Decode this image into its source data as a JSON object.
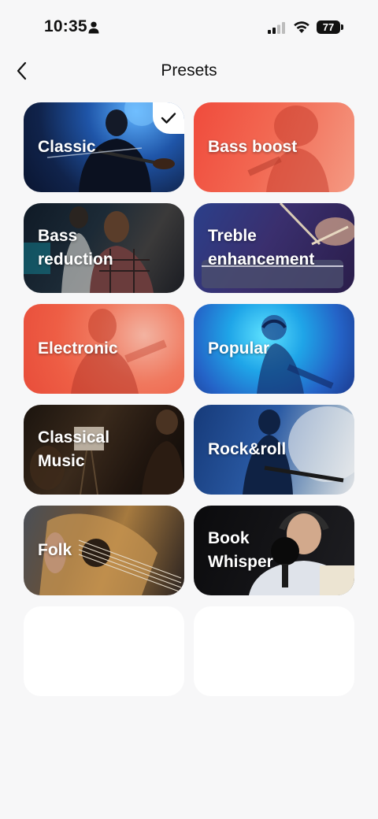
{
  "status_bar": {
    "time": "10:35",
    "battery": "77",
    "icons": [
      "person-icon",
      "signal-icon",
      "wifi-icon",
      "battery-icon"
    ]
  },
  "header": {
    "title": "Presets",
    "back_icon": "chevron-left-icon"
  },
  "presets": [
    {
      "label": "Classic",
      "selected": true
    },
    {
      "label": "Bass boost",
      "selected": false
    },
    {
      "label": "Bass\nreduction",
      "selected": false
    },
    {
      "label": "Treble\nenhancement",
      "selected": false
    },
    {
      "label": "Electronic",
      "selected": false
    },
    {
      "label": "Popular",
      "selected": false
    },
    {
      "label": "Classical\nMusic",
      "selected": false
    },
    {
      "label": "Rock&roll",
      "selected": false
    },
    {
      "label": "Folk",
      "selected": false
    },
    {
      "label": "Book\nWhisper",
      "selected": false
    }
  ],
  "colors": {
    "background": "#f7f7f8",
    "empty_card": "#ffffff",
    "check": "#111111"
  }
}
